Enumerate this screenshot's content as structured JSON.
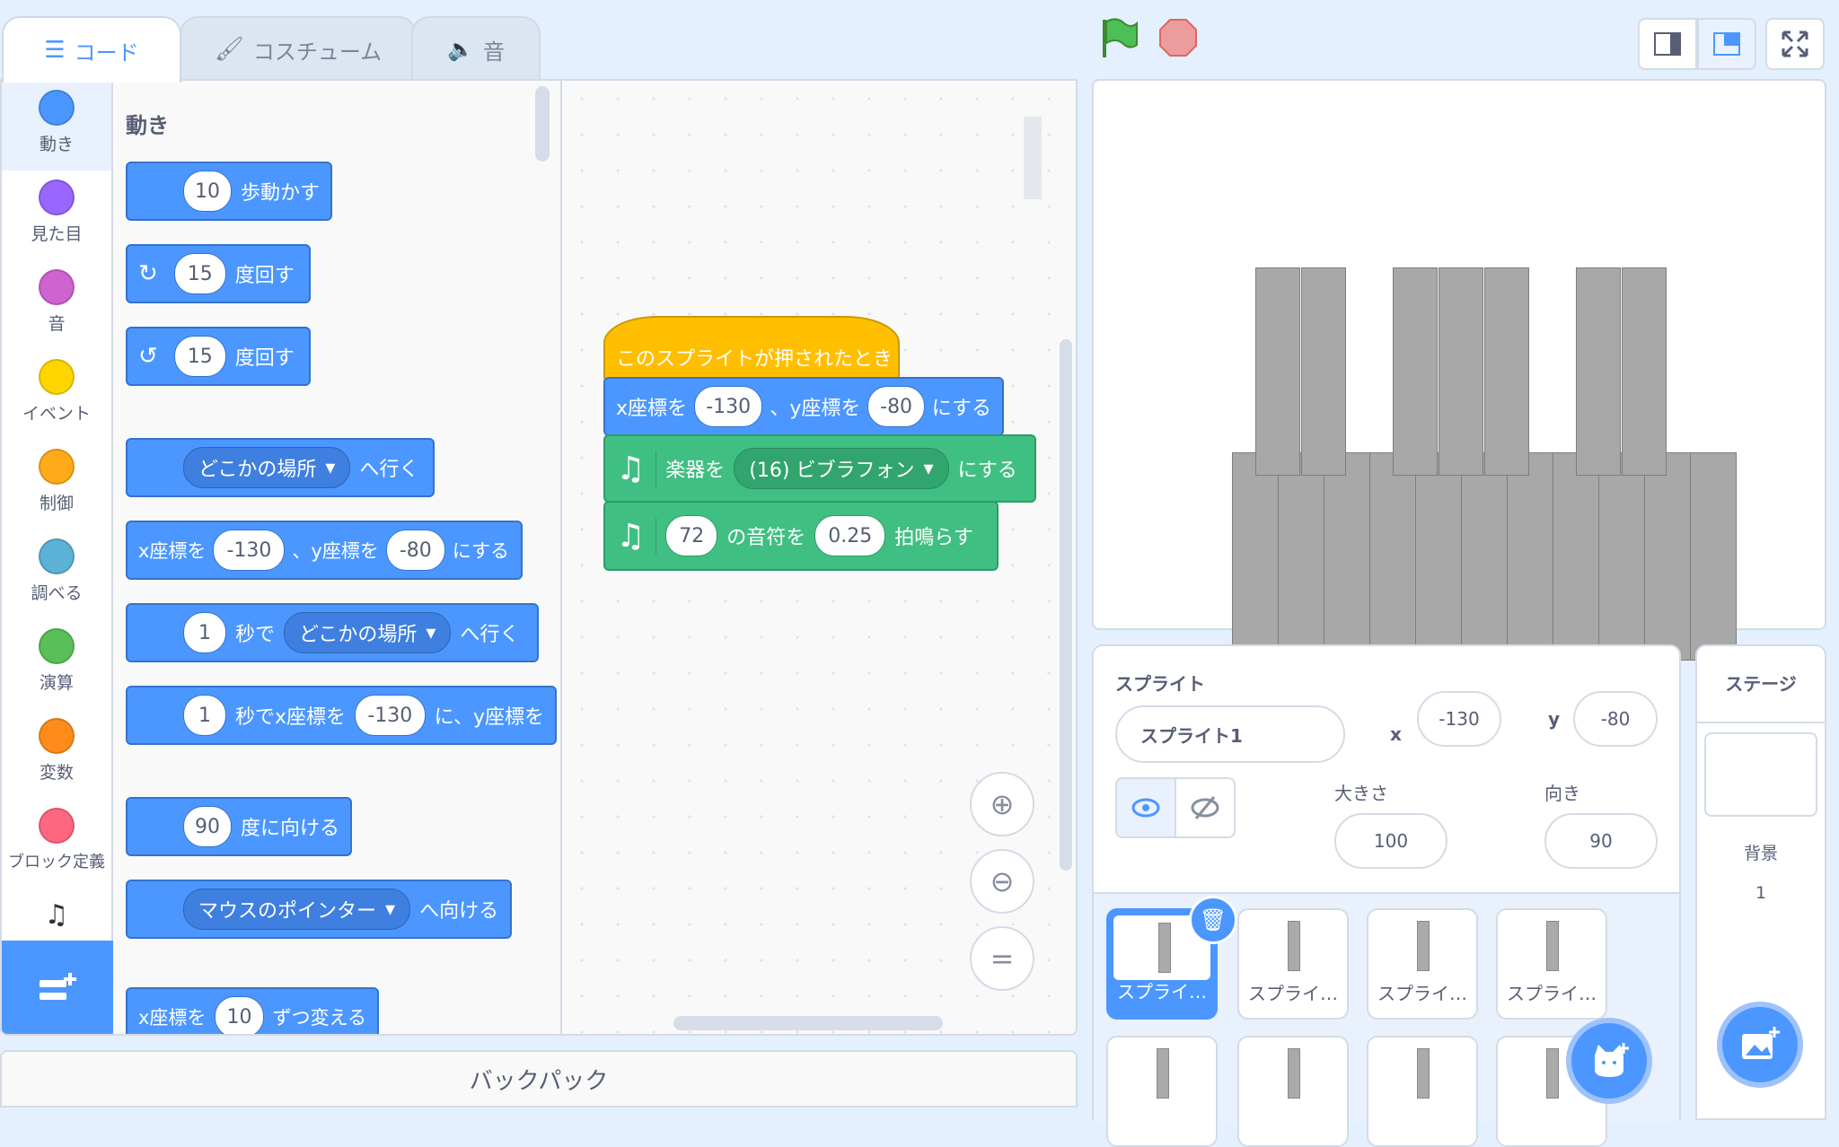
{
  "tabs": [
    {
      "label": "コード",
      "icon": "code-icon"
    },
    {
      "label": "コスチューム",
      "icon": "paintbrush-icon"
    },
    {
      "label": "音",
      "icon": "speaker-icon"
    }
  ],
  "categories": [
    {
      "label": "動き",
      "color": "#4c97ff"
    },
    {
      "label": "見た目",
      "color": "#9966ff"
    },
    {
      "label": "音",
      "color": "#cf63cf"
    },
    {
      "label": "イベント",
      "color": "#ffd500"
    },
    {
      "label": "制御",
      "color": "#ffab19"
    },
    {
      "label": "調べる",
      "color": "#5cb1d6"
    },
    {
      "label": "演算",
      "color": "#59c059"
    },
    {
      "label": "変数",
      "color": "#ff8c1a"
    },
    {
      "label": "ブロック定義",
      "color": "#ff6680"
    }
  ],
  "palette": {
    "heading": "動き",
    "move": {
      "steps": "10",
      "label": "歩動かす"
    },
    "turn_right": {
      "deg": "15",
      "label": "度回す"
    },
    "turn_left": {
      "deg": "15",
      "label": "度回す"
    },
    "goto": {
      "target": "どこかの場所",
      "label": "へ行く"
    },
    "gotoxy": {
      "x_label": "x座標を",
      "x": "-130",
      "sep": "、y座標を",
      "y": "-80",
      "end": "にする"
    },
    "glide": {
      "secs": "1",
      "mid": "秒で",
      "target": "どこかの場所",
      "end": "へ行く"
    },
    "glidexy": {
      "secs": "1",
      "mid": "秒でx座標を",
      "x": "-130",
      "end": "に、y座標を"
    },
    "point": {
      "deg": "90",
      "label": "度に向ける"
    },
    "pointto": {
      "target": "マウスのポインター",
      "label": "へ向ける"
    },
    "changex": {
      "label": "x座標を",
      "val": "10",
      "end": "ずつ変える"
    }
  },
  "script": {
    "hat": "このスプライトが押されたとき",
    "setxy": {
      "x_label": "x座標を",
      "x": "-130",
      "sep": "、y座標を",
      "y": "-80",
      "end": "にする"
    },
    "instrument": {
      "label": "楽器を",
      "value": "(16) ビブラフォン",
      "end": "にする"
    },
    "note": {
      "note": "72",
      "mid": "の音符を",
      "beats": "0.25",
      "end": "拍鳴らす"
    }
  },
  "backpack": "バックパック",
  "sprite_info": {
    "sprite_label": "スプライト",
    "name": "スプライト1",
    "x_label": "x",
    "x": "-130",
    "y_label": "y",
    "y": "-80",
    "size_label": "大きさ",
    "size": "100",
    "direction_label": "向き",
    "direction": "90"
  },
  "sprites": [
    "スプライ…",
    "スプライ…",
    "スプライ…",
    "スプライ…"
  ],
  "stage_panel": {
    "title": "ステージ",
    "backdrop_label": "背景",
    "backdrop_count": "1"
  },
  "colors": {
    "motion": "#4c97ff",
    "events": "#ffbf00",
    "music": "#40bf83",
    "accent": "#4c97ff"
  }
}
